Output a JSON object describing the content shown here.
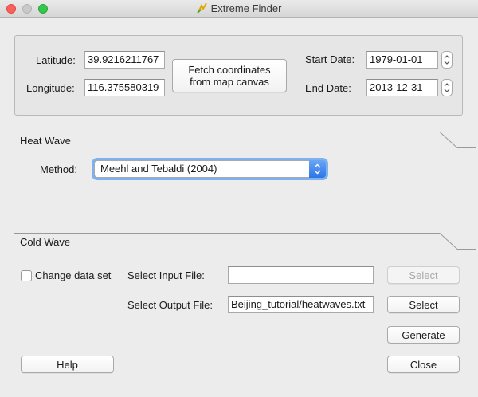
{
  "window": {
    "title": "Extreme Finder"
  },
  "coordinates": {
    "latitude_label": "Latitude:",
    "latitude_value": "39.9216211767",
    "longitude_label": "Longitude:",
    "longitude_value": "116.375580319",
    "fetch_button_line1": "Fetch coordinates",
    "fetch_button_line2": "from map canvas",
    "start_date_label": "Start Date:",
    "start_date_value": "1979-01-01",
    "end_date_label": "End Date:",
    "end_date_value": "2013-12-31"
  },
  "heat_wave": {
    "title": "Heat Wave",
    "method_label": "Method:",
    "method_value": "Meehl and Tebaldi (2004)"
  },
  "cold_wave": {
    "title": "Cold Wave",
    "change_data_set_label": "Change data set",
    "change_data_set_checked": false,
    "select_input_label": "Select Input File:",
    "select_input_value": "",
    "select_input_button": "Select",
    "select_output_label": "Select Output File:",
    "select_output_value": "Beijing_tutorial/heatwaves.txt",
    "select_output_button": "Select"
  },
  "actions": {
    "generate": "Generate",
    "help": "Help",
    "close": "Close"
  },
  "colors": {
    "focus_ring": "#7db2ee",
    "select_accent": "#2d74e6",
    "close_light": "#fc605c",
    "max_light": "#34c84a"
  }
}
